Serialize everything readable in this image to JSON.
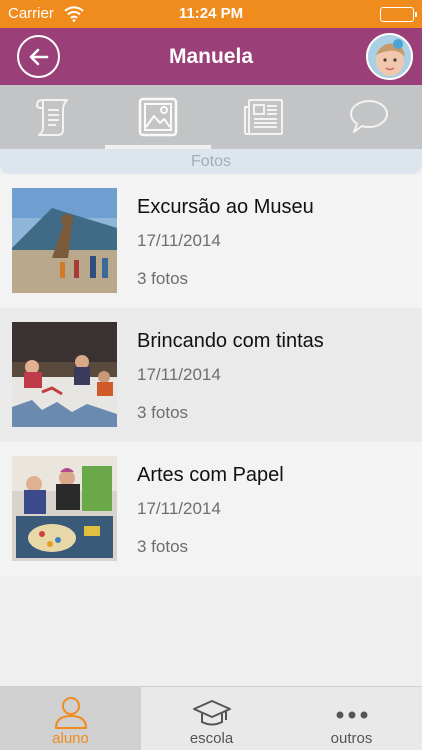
{
  "status_bar": {
    "carrier": "Carrier",
    "time": "11:24 PM"
  },
  "nav": {
    "title": "Manuela"
  },
  "section": {
    "label": "Fotos"
  },
  "albums": [
    {
      "title": "Excursão ao Museu",
      "date": "17/11/2014",
      "count": "3 fotos"
    },
    {
      "title": "Brincando com tintas",
      "date": "17/11/2014",
      "count": "3 fotos"
    },
    {
      "title": "Artes com Papel",
      "date": "17/11/2014",
      "count": "3 fotos"
    }
  ],
  "tab_bar": {
    "items": [
      {
        "label": "aluno"
      },
      {
        "label": "escola"
      },
      {
        "label": "outros"
      }
    ]
  },
  "colors": {
    "accent": "#ef8c1d",
    "nav": "#9a3f77"
  }
}
